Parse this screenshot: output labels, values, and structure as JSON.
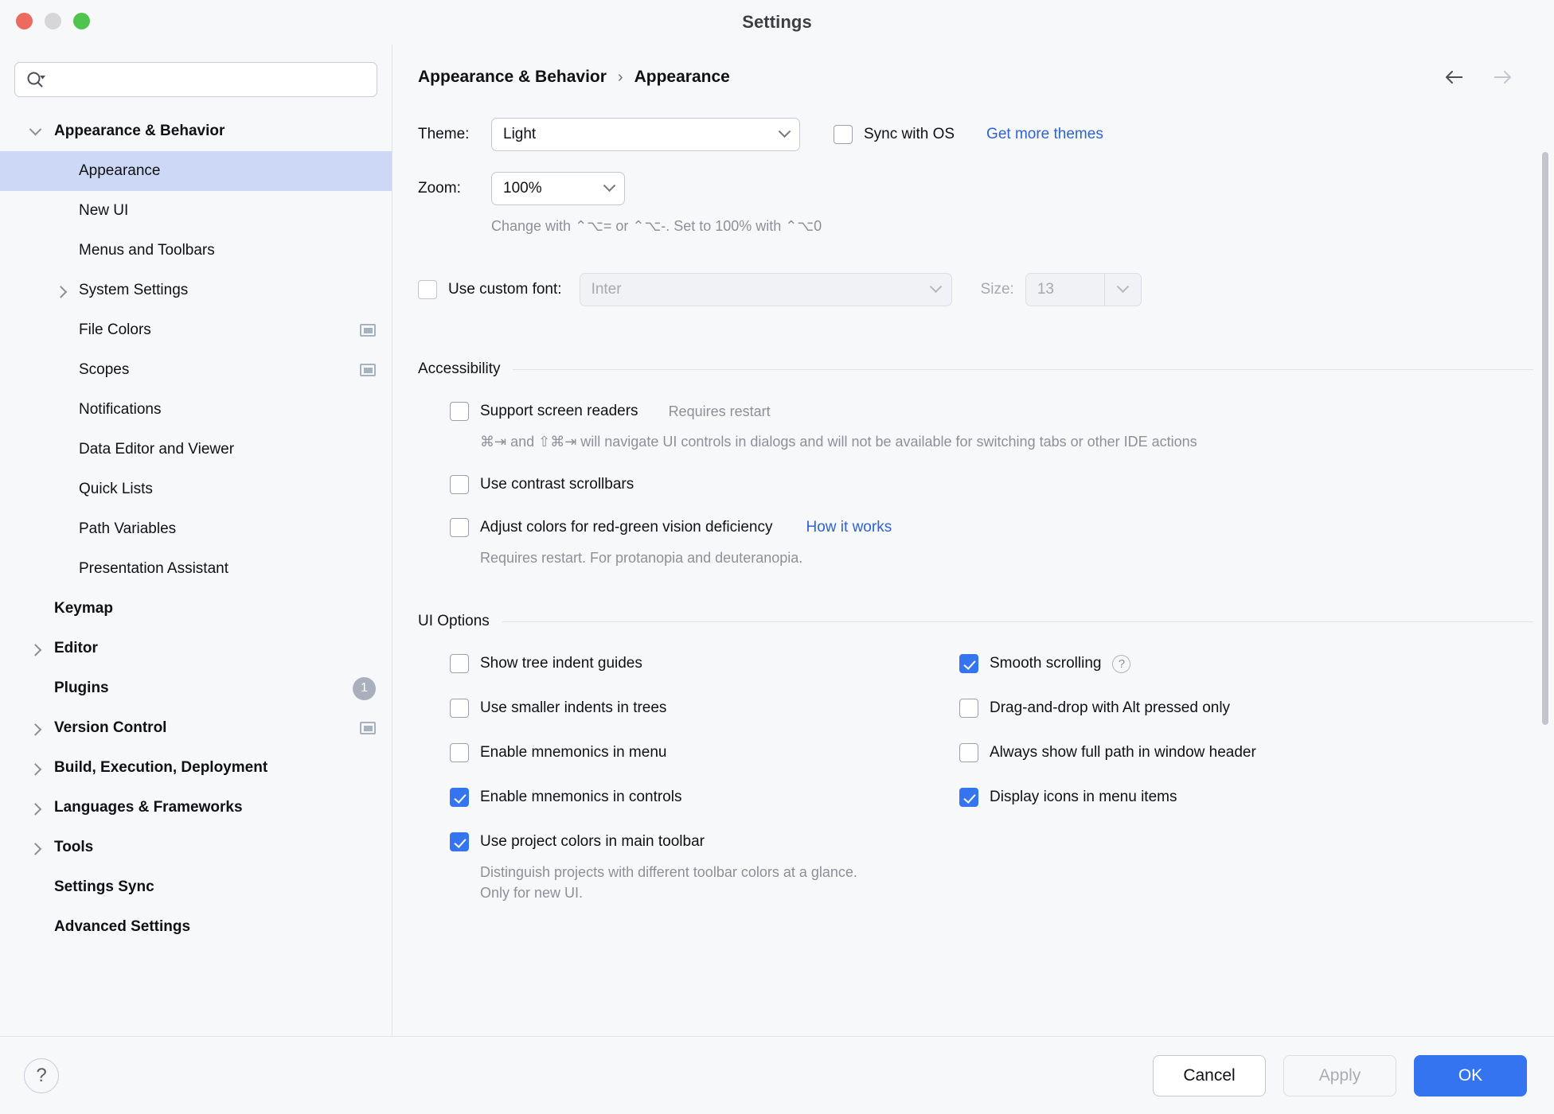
{
  "window": {
    "title": "Settings",
    "traffic_lights": [
      "close",
      "minimize",
      "zoom"
    ]
  },
  "sidebar": {
    "search": {
      "value": "",
      "placeholder": ""
    },
    "items": [
      {
        "label": "Appearance & Behavior",
        "level": 0,
        "bold": true,
        "expanded": true,
        "arrow": "down",
        "selected": false
      },
      {
        "label": "Appearance",
        "level": 1,
        "bold": false,
        "arrow": "none",
        "selected": true
      },
      {
        "label": "New UI",
        "level": 1,
        "bold": false,
        "arrow": "none",
        "selected": false
      },
      {
        "label": "Menus and Toolbars",
        "level": 1,
        "bold": false,
        "arrow": "none",
        "selected": false
      },
      {
        "label": "System Settings",
        "level": 1,
        "bold": false,
        "arrow": "right",
        "selected": false
      },
      {
        "label": "File Colors",
        "level": 1,
        "bold": false,
        "arrow": "none",
        "selected": false,
        "project_icon": true
      },
      {
        "label": "Scopes",
        "level": 1,
        "bold": false,
        "arrow": "none",
        "selected": false,
        "project_icon": true
      },
      {
        "label": "Notifications",
        "level": 1,
        "bold": false,
        "arrow": "none",
        "selected": false
      },
      {
        "label": "Data Editor and Viewer",
        "level": 1,
        "bold": false,
        "arrow": "none",
        "selected": false
      },
      {
        "label": "Quick Lists",
        "level": 1,
        "bold": false,
        "arrow": "none",
        "selected": false
      },
      {
        "label": "Path Variables",
        "level": 1,
        "bold": false,
        "arrow": "none",
        "selected": false
      },
      {
        "label": "Presentation Assistant",
        "level": 1,
        "bold": false,
        "arrow": "none",
        "selected": false
      },
      {
        "label": "Keymap",
        "level": 0,
        "bold": true,
        "arrow": "none",
        "selected": false
      },
      {
        "label": "Editor",
        "level": 0,
        "bold": true,
        "arrow": "right",
        "selected": false
      },
      {
        "label": "Plugins",
        "level": 0,
        "bold": true,
        "arrow": "none",
        "selected": false,
        "badge": "1"
      },
      {
        "label": "Version Control",
        "level": 0,
        "bold": true,
        "arrow": "right",
        "selected": false,
        "project_icon": true
      },
      {
        "label": "Build, Execution, Deployment",
        "level": 0,
        "bold": true,
        "arrow": "right",
        "selected": false
      },
      {
        "label": "Languages & Frameworks",
        "level": 0,
        "bold": true,
        "arrow": "right",
        "selected": false
      },
      {
        "label": "Tools",
        "level": 0,
        "bold": true,
        "arrow": "right",
        "selected": false
      },
      {
        "label": "Settings Sync",
        "level": 0,
        "bold": true,
        "arrow": "none",
        "selected": false
      },
      {
        "label": "Advanced Settings",
        "level": 0,
        "bold": true,
        "arrow": "none",
        "selected": false
      }
    ]
  },
  "content": {
    "breadcrumb": {
      "parent": "Appearance & Behavior",
      "separator": "›",
      "current": "Appearance"
    },
    "nav": {
      "back_icon": "arrow-left-icon",
      "forward_icon": "arrow-right-icon"
    },
    "theme": {
      "label": "Theme:",
      "value": "Light",
      "sync_with_os_label": "Sync with OS",
      "sync_with_os_checked": false,
      "get_more_themes_link": "Get more themes"
    },
    "zoom": {
      "label": "Zoom:",
      "value": "100%",
      "hint": "Change with ⌃⌥= or ⌃⌥-. Set to 100% with ⌃⌥0"
    },
    "custom_font": {
      "label": "Use custom font:",
      "checked": false,
      "font_value": "Inter",
      "size_label": "Size:",
      "size_value": "13"
    },
    "accessibility": {
      "title": "Accessibility",
      "screen_readers": {
        "label": "Support screen readers",
        "checked": false,
        "note": "Requires restart",
        "description": "⌘⇥ and ⇧⌘⇥ will navigate UI controls in dialogs and will not be available for switching tabs or other IDE actions"
      },
      "contrast_scrollbars": {
        "label": "Use contrast scrollbars",
        "checked": false
      },
      "red_green": {
        "label": "Adjust colors for red-green vision deficiency",
        "checked": false,
        "link": "How it works",
        "description": "Requires restart. For protanopia and deuteranopia."
      }
    },
    "ui_options": {
      "title": "UI Options",
      "left_column": [
        {
          "label": "Show tree indent guides",
          "checked": false
        },
        {
          "label": "Use smaller indents in trees",
          "checked": false
        },
        {
          "label": "Enable mnemonics in menu",
          "checked": false
        },
        {
          "label": "Enable mnemonics in controls",
          "checked": true
        },
        {
          "label": "Use project colors in main toolbar",
          "checked": true
        }
      ],
      "left_column_note": "Distinguish projects with different toolbar colors at a glance. Only for new UI.",
      "right_column": [
        {
          "label": "Smooth scrolling",
          "checked": true,
          "help": "?"
        },
        {
          "label": "Drag-and-drop with Alt pressed only",
          "checked": false
        },
        {
          "label": "Always show full path in window header",
          "checked": false
        },
        {
          "label": "Display icons in menu items",
          "checked": true
        }
      ]
    }
  },
  "footer": {
    "help_label": "?",
    "cancel_label": "Cancel",
    "apply_label": "Apply",
    "ok_label": "OK"
  },
  "colors": {
    "accent": "#3574f0",
    "link": "#2f62d6",
    "selection": "#ccd8f5",
    "background": "#f7f8fa",
    "muted_text": "#8c9099"
  }
}
